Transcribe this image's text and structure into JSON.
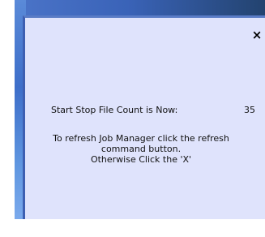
{
  "dialog": {
    "close_label": "×",
    "count_label": "Start Stop File Count is Now:",
    "count_value": "35",
    "message_line1": "To refresh Job Manager click the refresh",
    "message_line2": "command button.",
    "message_line3": "Otherwise Click the 'X'"
  },
  "colors": {
    "dialog_bg": "#dfe3fc",
    "frame_blue": "#3d5fb2",
    "desktop_blue": "#4b74c8"
  }
}
